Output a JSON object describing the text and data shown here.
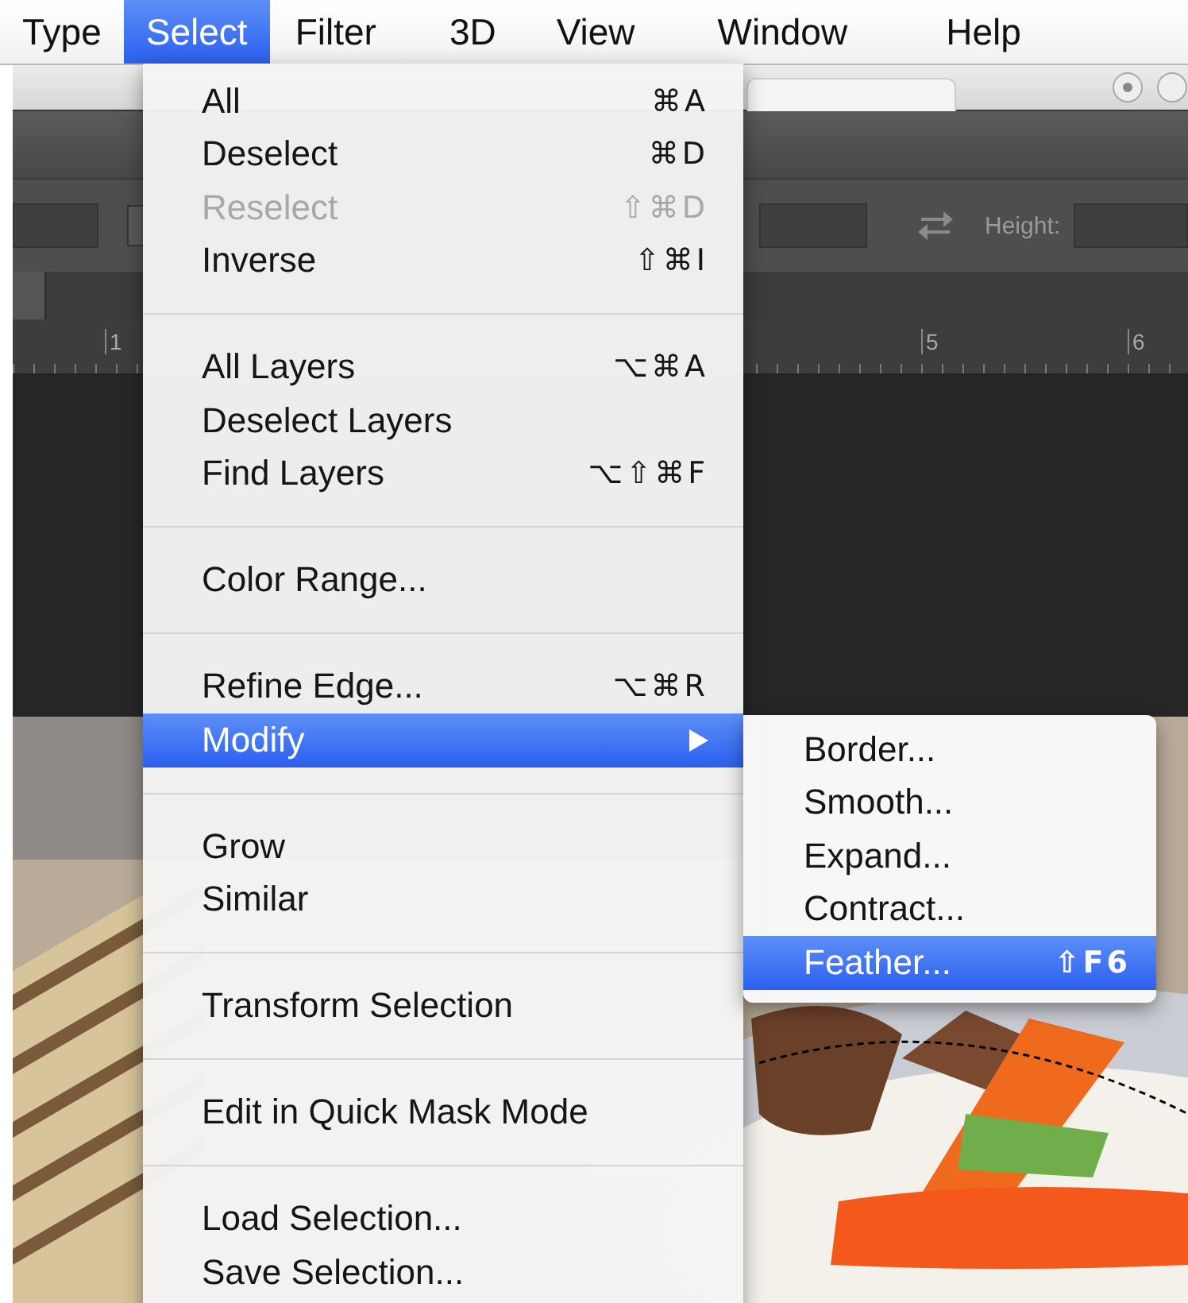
{
  "menu_bar": [
    {
      "label": "Type",
      "selected": false
    },
    {
      "label": "Select",
      "selected": true
    },
    {
      "label": "Filter",
      "selected": false
    },
    {
      "label": "3D",
      "selected": false
    },
    {
      "label": "View",
      "selected": false
    },
    {
      "label": "Window",
      "selected": false
    },
    {
      "label": "Help",
      "selected": false
    }
  ],
  "options_bar": {
    "height_label": "Height:"
  },
  "ruler": {
    "labels": [
      "1",
      "5",
      "6"
    ]
  },
  "select_menu": {
    "items": [
      {
        "kind": "item",
        "label": "All",
        "shortcut": "⌘A",
        "disabled": false,
        "selected": false,
        "submenu": false
      },
      {
        "kind": "item",
        "label": "Deselect",
        "shortcut": "⌘D",
        "disabled": false,
        "selected": false,
        "submenu": false
      },
      {
        "kind": "item",
        "label": "Reselect",
        "shortcut": "⇧⌘D",
        "disabled": true,
        "selected": false,
        "submenu": false
      },
      {
        "kind": "item",
        "label": "Inverse",
        "shortcut": "⇧⌘I",
        "disabled": false,
        "selected": false,
        "submenu": false
      },
      {
        "kind": "separator"
      },
      {
        "kind": "item",
        "label": "All Layers",
        "shortcut": "⌥⌘A",
        "disabled": false,
        "selected": false,
        "submenu": false
      },
      {
        "kind": "item",
        "label": "Deselect Layers",
        "disabled": false,
        "selected": false,
        "submenu": false
      },
      {
        "kind": "item",
        "label": "Find Layers",
        "shortcut": "⌥⇧⌘F",
        "disabled": false,
        "selected": false,
        "submenu": false
      },
      {
        "kind": "separator"
      },
      {
        "kind": "item",
        "label": "Color Range...",
        "disabled": false,
        "selected": false,
        "submenu": false
      },
      {
        "kind": "separator"
      },
      {
        "kind": "item",
        "label": "Refine Edge...",
        "shortcut": "⌥⌘R",
        "disabled": false,
        "selected": false,
        "submenu": false
      },
      {
        "kind": "item",
        "label": "Modify",
        "disabled": false,
        "selected": true,
        "submenu": true
      },
      {
        "kind": "separator"
      },
      {
        "kind": "item",
        "label": "Grow",
        "disabled": false,
        "selected": false,
        "submenu": false
      },
      {
        "kind": "item",
        "label": "Similar",
        "disabled": false,
        "selected": false,
        "submenu": false
      },
      {
        "kind": "separator"
      },
      {
        "kind": "item",
        "label": "Transform Selection",
        "disabled": false,
        "selected": false,
        "submenu": false
      },
      {
        "kind": "separator"
      },
      {
        "kind": "item",
        "label": "Edit in Quick Mask Mode",
        "disabled": false,
        "selected": false,
        "submenu": false
      },
      {
        "kind": "separator"
      },
      {
        "kind": "item",
        "label": "Load Selection...",
        "disabled": false,
        "selected": false,
        "submenu": false
      },
      {
        "kind": "item",
        "label": "Save Selection...",
        "disabled": false,
        "selected": false,
        "submenu": false
      }
    ]
  },
  "modify_submenu": {
    "items": [
      {
        "label": "Border...",
        "selected": false
      },
      {
        "label": "Smooth...",
        "selected": false
      },
      {
        "label": "Expand...",
        "selected": false
      },
      {
        "label": "Contract...",
        "selected": false
      },
      {
        "label": "Feather...",
        "shortcut": "⇧F6",
        "selected": true
      }
    ]
  }
}
